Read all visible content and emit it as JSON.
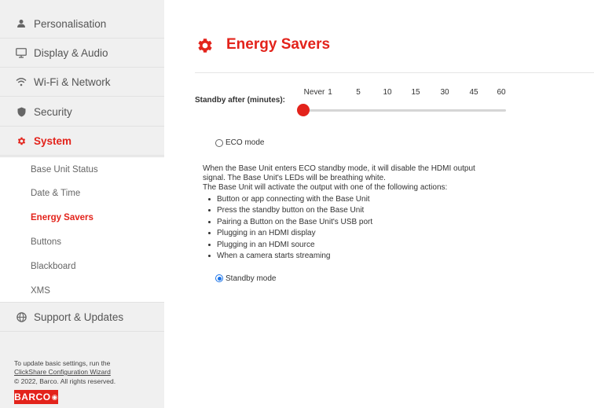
{
  "sidebar": {
    "items": [
      {
        "name": "personalisation",
        "label": "Personalisation",
        "icon": "person-icon"
      },
      {
        "name": "display-audio",
        "label": "Display & Audio",
        "icon": "monitor-icon"
      },
      {
        "name": "wifi-network",
        "label": "Wi-Fi & Network",
        "icon": "wifi-icon"
      },
      {
        "name": "security",
        "label": "Security",
        "icon": "shield-icon"
      },
      {
        "name": "system",
        "label": "System",
        "icon": "gear-icon",
        "active": true
      },
      {
        "name": "support-updates",
        "label": "Support & Updates",
        "icon": "globe-icon"
      }
    ],
    "system_sub": [
      {
        "label": "Base Unit Status"
      },
      {
        "label": "Date & Time"
      },
      {
        "label": "Energy Savers",
        "active": true
      },
      {
        "label": "Buttons"
      },
      {
        "label": "Blackboard"
      },
      {
        "label": "XMS"
      }
    ],
    "footer": {
      "line1": "To update basic settings, run the",
      "link": "ClickShare Configuration Wizard",
      "copyright": "© 2022, Barco. All rights reserved.",
      "logo": "BARCO"
    }
  },
  "main": {
    "title": "Energy Savers",
    "title_icon": "gear-icon",
    "standby": {
      "label": "Standby after (minutes):",
      "ticks": [
        "Never",
        "1",
        "5",
        "10",
        "15",
        "30",
        "45",
        "60"
      ],
      "selected": "Never"
    },
    "eco": {
      "label": "ECO mode",
      "checked": false
    },
    "description": [
      "When the Base Unit enters ECO standby mode, it will disable the HDMI output",
      "signal. The Base Unit's LEDs will be breathing white.",
      "The Base Unit will activate the output with one of the following actions:"
    ],
    "actions": [
      "Button or app connecting with the Base Unit",
      "Press the standby button on the Base Unit",
      "Pairing a Button on the Base Unit's USB port",
      "Plugging in an HDMI display",
      "Plugging in an HDMI source",
      "When a camera starts streaming"
    ],
    "standby_mode": {
      "label": "Standby mode",
      "checked": true
    },
    "colors": {
      "accent": "#e3231b",
      "radio_checked": "#1a73e8",
      "sidebar_bg": "#f0f0f0"
    }
  }
}
